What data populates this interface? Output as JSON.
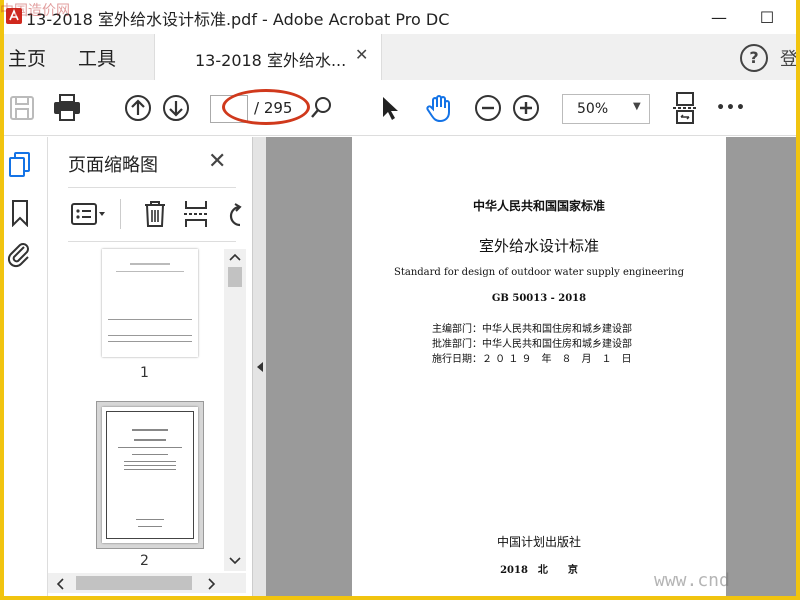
{
  "window": {
    "title": "13-2018 室外给水设计标准.pdf - Adobe Acrobat Pro DC",
    "minimize": "—",
    "maximize": "☐"
  },
  "nav": {
    "home": "主页",
    "tools": "工具",
    "doc_tab": "13-2018 室外给水...",
    "doc_tab_close": "✕",
    "help": "?",
    "login": "登"
  },
  "toolbar": {
    "page_current": "",
    "page_total": "/ 295",
    "zoom": "50%",
    "more": "•••"
  },
  "thumbnails": {
    "title": "页面缩略图",
    "close": "✕",
    "pages": [
      {
        "label": "1"
      },
      {
        "label": "2"
      }
    ]
  },
  "document": {
    "issuer": "中华人民共和国国家标准",
    "title_cn": "室外给水设计标准",
    "title_en": "Standard for design of outdoor water supply engineering",
    "code": "GB 50013 - 2018",
    "chief_dept": "主编部门：中华人民共和国住房和城乡建设部",
    "approve_dept": "批准部门：中华人民共和国住房和城乡建设部",
    "effective": "施行日期：２ ０ １ ９　年　８　月　１　日",
    "publisher": "中国计划出版社",
    "pub_place": "2018　北　　京"
  },
  "watermarks": {
    "top_left": "中国造价网",
    "bottom_right": "www.cnd"
  },
  "colors": {
    "accent_blue": "#1473e6",
    "annotation_red": "#d0391c",
    "frame_yellow": "#f1c40f"
  }
}
